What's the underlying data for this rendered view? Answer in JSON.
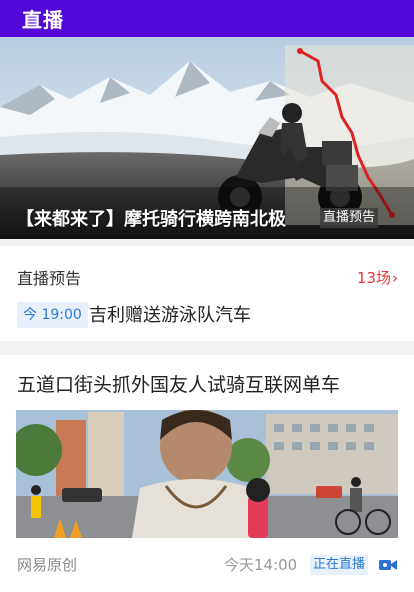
{
  "topbar": {
    "title": "直播"
  },
  "hero": {
    "caption": "【来都来了】摩托骑行横跨南北极",
    "tag": "直播预告"
  },
  "preview_section": {
    "title": "直播预告",
    "count": "13场",
    "time_badge": "今 19:00",
    "event_title": "吉利赠送游泳队汽车"
  },
  "article": {
    "headline": "五道口街头抓外国友人试骑互联网单车",
    "source": "网易原创",
    "time": "今天14:00",
    "live_badge": "正在直播",
    "video_icon": "video-camera-icon"
  },
  "colors": {
    "topbar": "#5209d8",
    "accent_red": "#e03c3c",
    "badge_blue": "#2d7ad6",
    "badge_bg": "#e7f0fb"
  }
}
